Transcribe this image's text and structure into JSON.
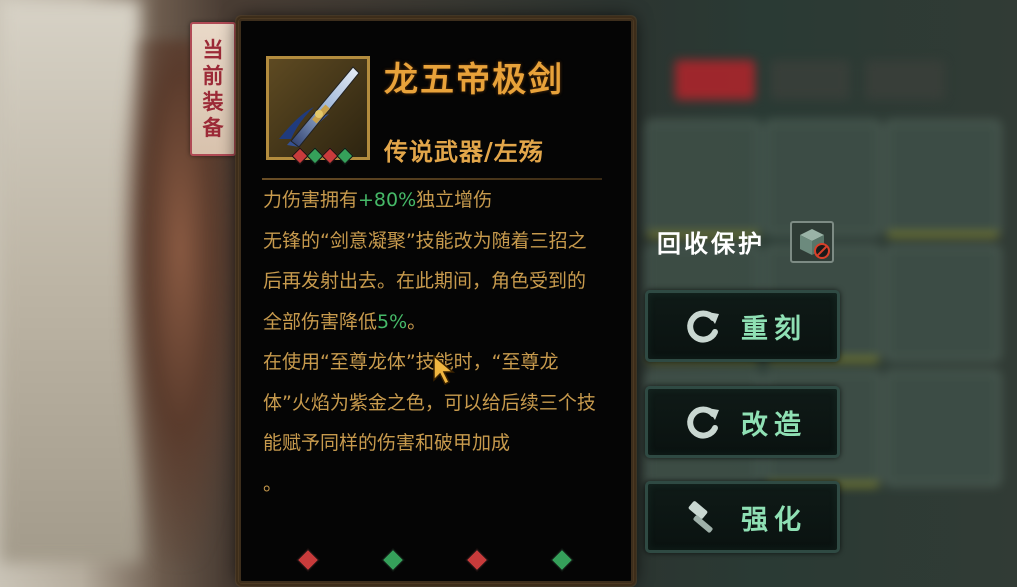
{
  "equip_tag": [
    "当",
    "前",
    "装",
    "备"
  ],
  "item": {
    "name": "龙五帝极剑",
    "type": "传说武器/左殇"
  },
  "description": {
    "line1_prefix": "力伤害拥有",
    "line1_highlight": "+80%",
    "line1_suffix": "独立增伤",
    "para2_text": "无锋的“剑意凝聚”技能改为随着三招之后再发射出去。在此期间，角色受到的全部伤害降低",
    "para2_highlight": "5%",
    "para2_end": "。",
    "para3_text": "在使用“至尊龙体”技能时，“至尊龙体”火焰为紫金之色，可以给后续三个技能赋予同样的伤害和破甲加成",
    "para3_end": "。"
  },
  "recycle": {
    "label": "回收保护"
  },
  "actions": [
    {
      "label": "重刻",
      "icon": "refresh-icon"
    },
    {
      "label": "改造",
      "icon": "refresh-icon"
    },
    {
      "label": "强化",
      "icon": "hammer-icon"
    }
  ],
  "colors": {
    "gold_text": "#e8a23a",
    "desc_text": "#c79a4d",
    "highlight_green": "#46b968",
    "button_text": "#8fe0b4",
    "tag_red": "#9c2a37"
  }
}
